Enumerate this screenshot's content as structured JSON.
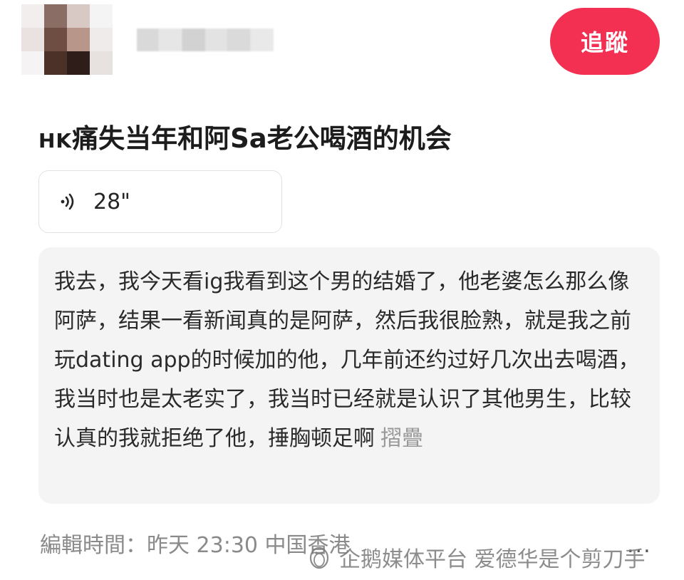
{
  "header": {
    "follow_label": "追蹤"
  },
  "post": {
    "title_prefix": "HK",
    "title_rest": "痛失当年和阿Sa老公喝酒的机会",
    "voice": {
      "duration": "28\""
    },
    "transcript": "我去，我今天看ig我看到这个男的结婚了，他老婆怎么那么像阿萨，结果一看新闻真的是阿萨，然后我很脸熟，就是我之前玩dating app的时候加的他，几年前还约过好几次出去喝酒，我当时也是太老实了，我当时已经就是认识了其他男生，比较认真的我就拒绝了他，捶胸顿足啊",
    "collapse_label": "摺疊",
    "edit_time": "編輯時間：昨天 23:30 中国香港",
    "more_label": "..."
  },
  "watermark": {
    "text": "企鹅媒体平台 爱德华是个剪刀手"
  },
  "colors": {
    "follow_button": "#f33052",
    "transcript_bg": "#f4f4f4",
    "collapse_link": "#9a9a9a"
  }
}
